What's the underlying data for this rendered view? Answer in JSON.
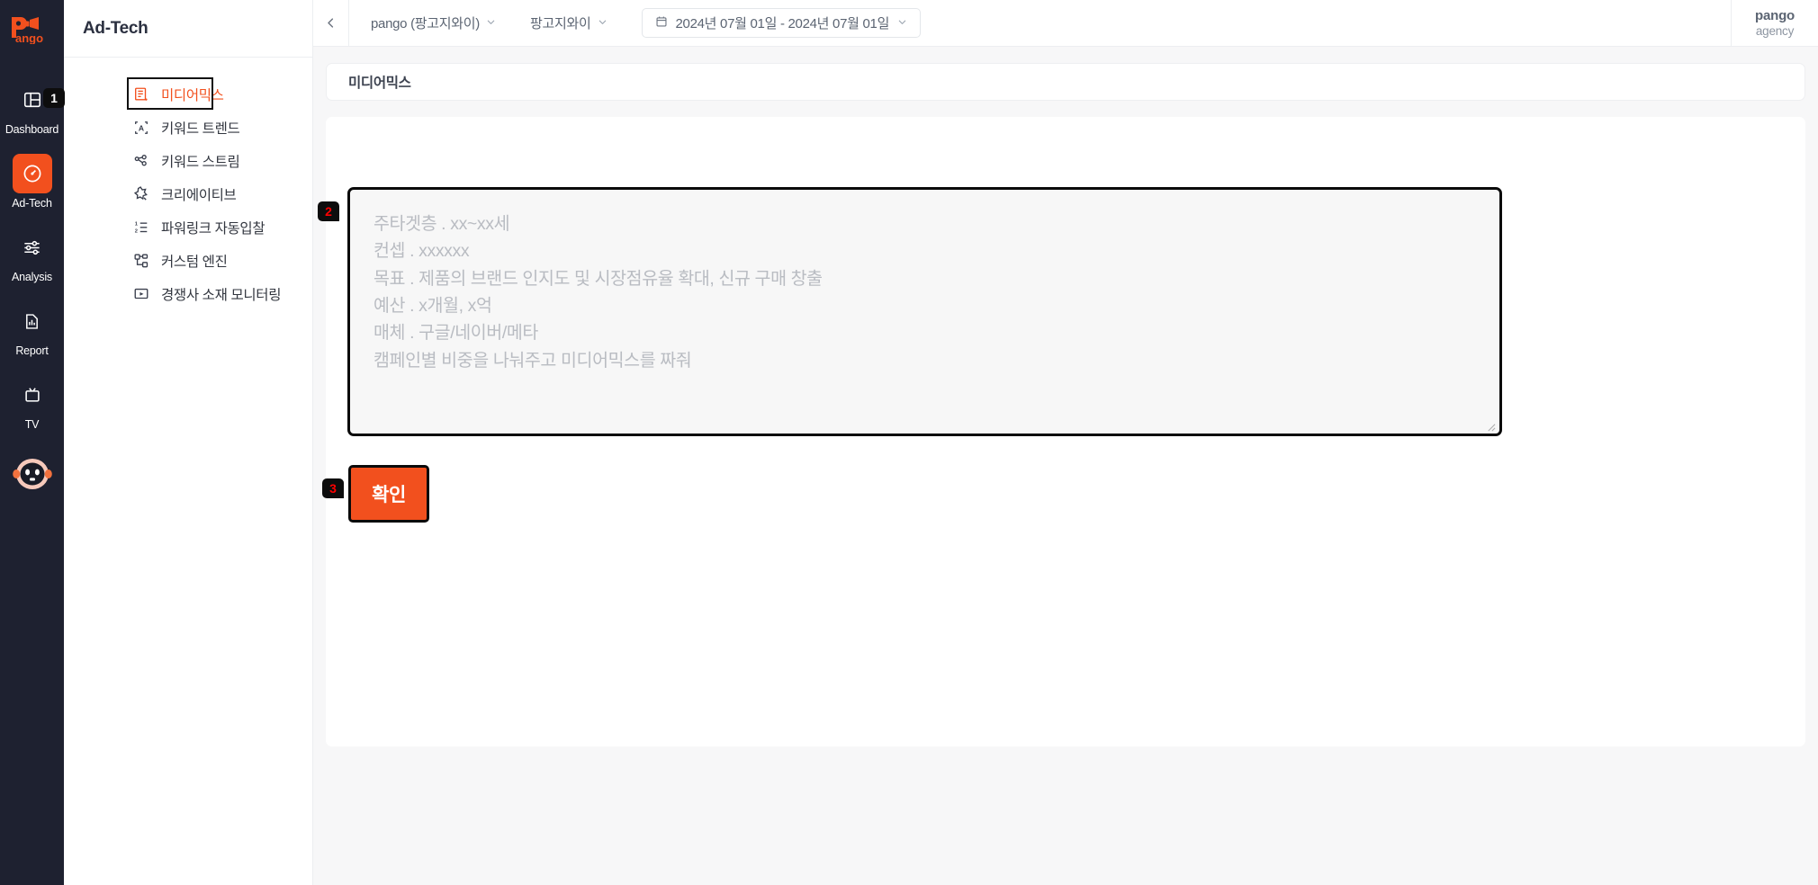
{
  "brand": {
    "logo_text": "Pango",
    "logo_icon": "pango-megaphone-logo"
  },
  "rail": {
    "items": [
      {
        "label": "Dashboard",
        "icon": "dashboard-grid-icon",
        "active": false
      },
      {
        "label": "Ad-Tech",
        "icon": "speedometer-icon",
        "active": true
      },
      {
        "label": "Analysis",
        "icon": "sliders-icon",
        "active": false
      },
      {
        "label": "Report",
        "icon": "report-chart-icon",
        "active": false
      },
      {
        "label": "TV",
        "icon": "tv-icon",
        "active": false
      }
    ],
    "bot_icon": "bot-avatar-icon"
  },
  "sidebar": {
    "title": "Ad-Tech",
    "items": [
      {
        "label": "미디어믹스",
        "icon": "media-mix-list-icon",
        "active": true
      },
      {
        "label": "키워드 트렌드",
        "icon": "keyword-trend-icon",
        "active": false
      },
      {
        "label": "키워드 스트림",
        "icon": "keyword-stream-icon",
        "active": false
      },
      {
        "label": "크리에이티브",
        "icon": "creative-sparkle-icon",
        "active": false
      },
      {
        "label": "파워링크 자동입찰",
        "icon": "auto-bidding-list-icon",
        "active": false
      },
      {
        "label": "커스텀 엔진",
        "icon": "custom-engine-icon",
        "active": false
      },
      {
        "label": "경쟁사 소재 모니터링",
        "icon": "monitoring-screen-icon",
        "active": false
      }
    ]
  },
  "topbar": {
    "collapse_icon": "chevron-left-icon",
    "account_picker": {
      "label": "pango (팡고지와이)",
      "caret_icon": "chevron-down-icon"
    },
    "advertiser_picker": {
      "label": "팡고지와이",
      "caret_icon": "chevron-down-icon"
    },
    "date_range": {
      "calendar_icon": "calendar-icon",
      "label": "2024년 07월 01일 - 2024년 07월 01일",
      "caret_icon": "chevron-down-icon"
    },
    "user": {
      "name": "pango",
      "role": "agency"
    }
  },
  "main": {
    "page_title": "미디어믹스",
    "prompt": {
      "value": "",
      "placeholder": "주타겟층 . xx~xx세\n컨셉 . xxxxxx\n목표 . 제품의 브랜드 인지도 및 시장점유율 확대, 신규 구매 창출\n예산 . x개월, x억\n매체 . 구글/네이버/메타\n캠페인별 비중을 나눠주고 미디어믹스를 짜줘",
      "resize_handle_icon": "resize-grip-icon"
    },
    "confirm_label": "확인"
  },
  "annotations": [
    {
      "id": "1",
      "target": "sidebar-item-media-mix",
      "style": "white"
    },
    {
      "id": "2",
      "target": "prompt-textarea",
      "style": "red"
    },
    {
      "id": "3",
      "target": "confirm-button",
      "style": "red"
    }
  ],
  "colors": {
    "accent": "#f2501e",
    "rail_bg": "#1e2130",
    "page_bg": "#f7f7f8",
    "annotation_bg": "#0d0d0d",
    "annotation_red": "#ff0000"
  }
}
